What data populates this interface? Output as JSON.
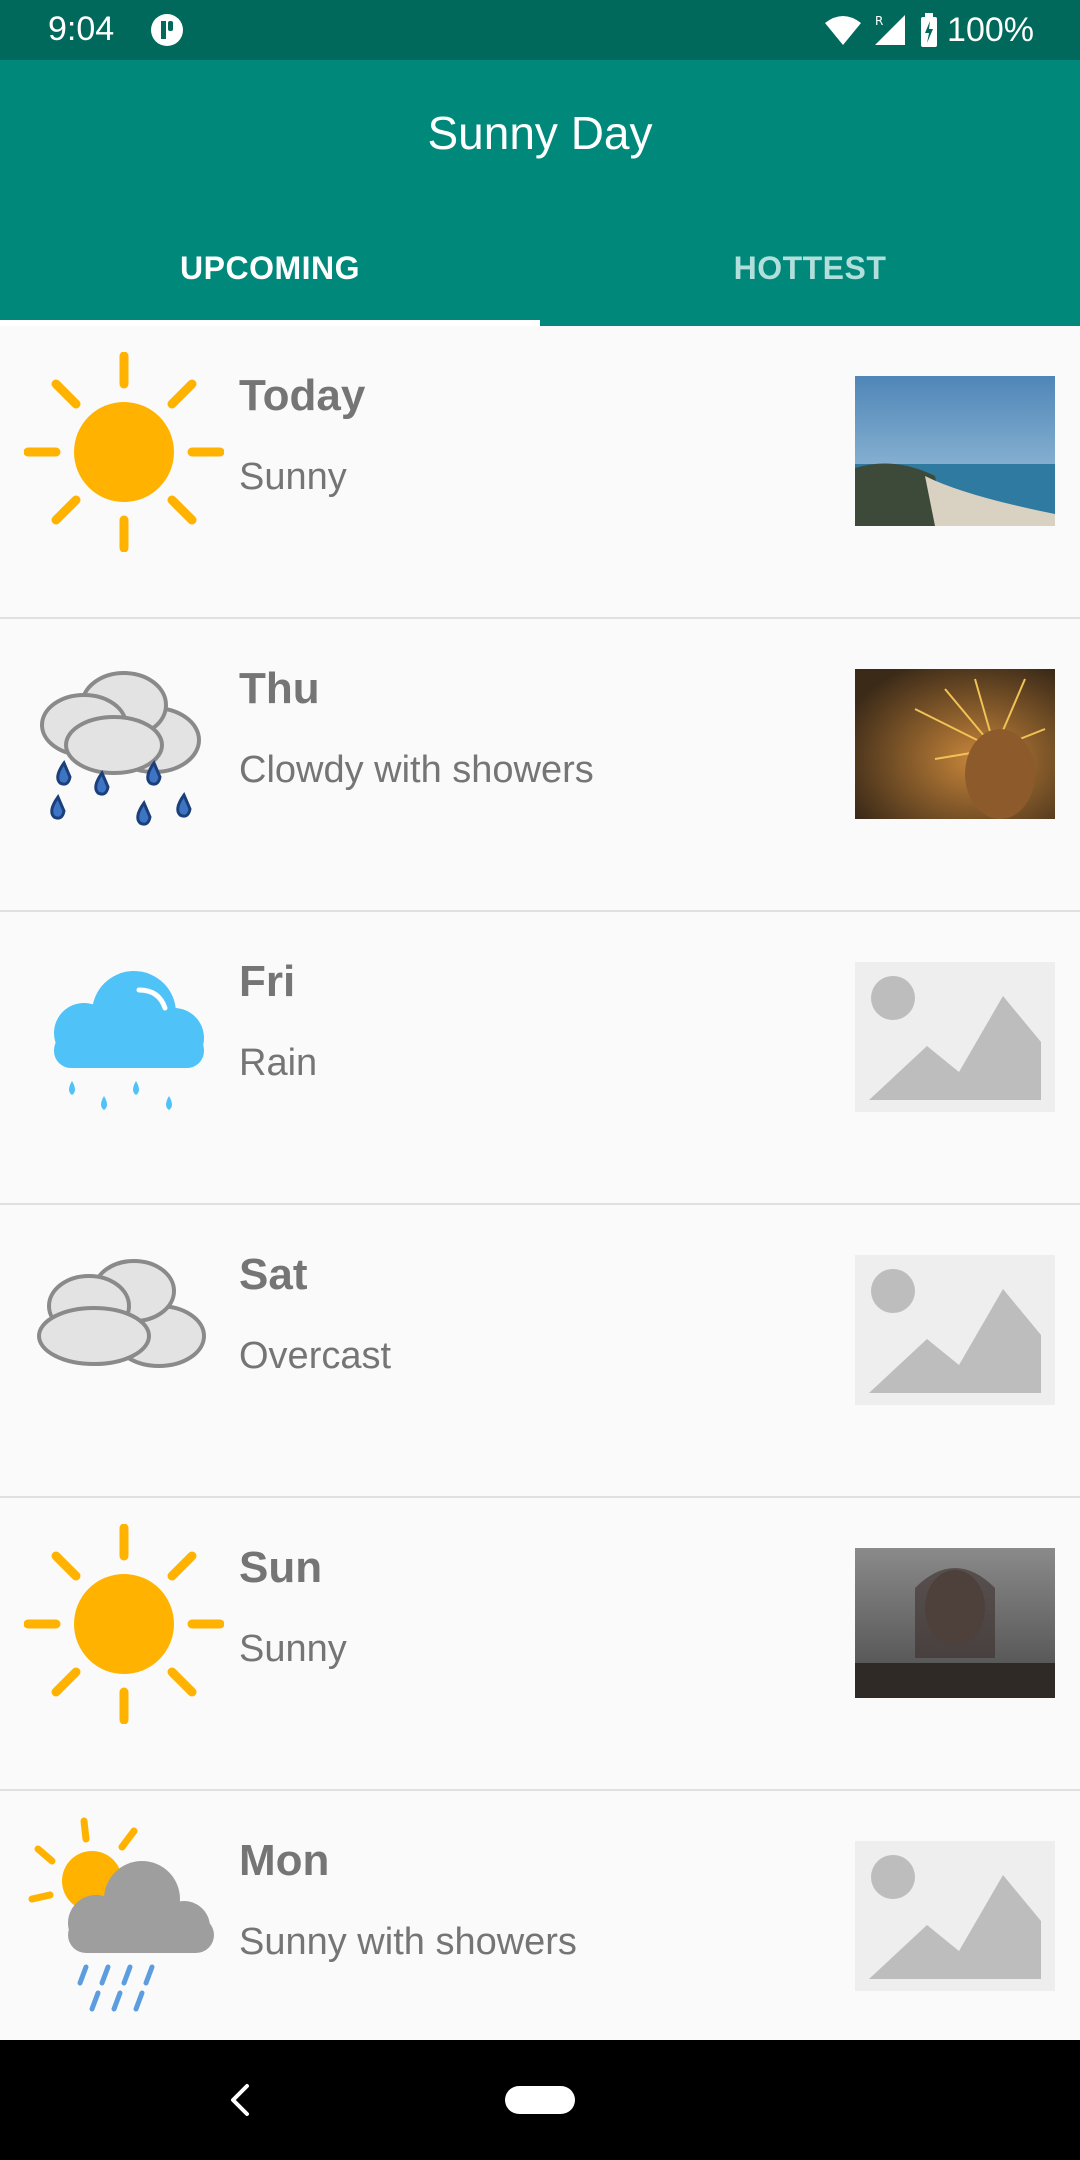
{
  "status_bar": {
    "time": "9:04",
    "battery": "100%"
  },
  "app_bar": {
    "title": "Sunny Day"
  },
  "tabs": [
    {
      "label": "UPCOMING",
      "active": true
    },
    {
      "label": "HOTTEST",
      "active": false
    }
  ],
  "forecast": [
    {
      "day": "Today",
      "description": "Sunny",
      "icon": "sun-icon",
      "thumbnail": "coastline-photo"
    },
    {
      "day": "Thu",
      "description": "Clowdy with showers",
      "icon": "cloud-showers-icon",
      "thumbnail": "cactus-photo"
    },
    {
      "day": "Fri",
      "description": "Rain",
      "icon": "rain-cloud-icon",
      "thumbnail": "image-placeholder-icon"
    },
    {
      "day": "Sat",
      "description": "Overcast",
      "icon": "overcast-icon",
      "thumbnail": "image-placeholder-icon"
    },
    {
      "day": "Sun",
      "description": "Sunny",
      "icon": "sun-icon",
      "thumbnail": "portrait-photo"
    },
    {
      "day": "Mon",
      "description": "Sunny with showers",
      "icon": "sun-cloud-rain-icon",
      "thumbnail": "image-placeholder-icon"
    }
  ],
  "colors": {
    "status_bar": "#00695c",
    "app_bar": "#00897b",
    "tab_inactive": "#b2dfdb",
    "text_secondary": "#757575"
  }
}
